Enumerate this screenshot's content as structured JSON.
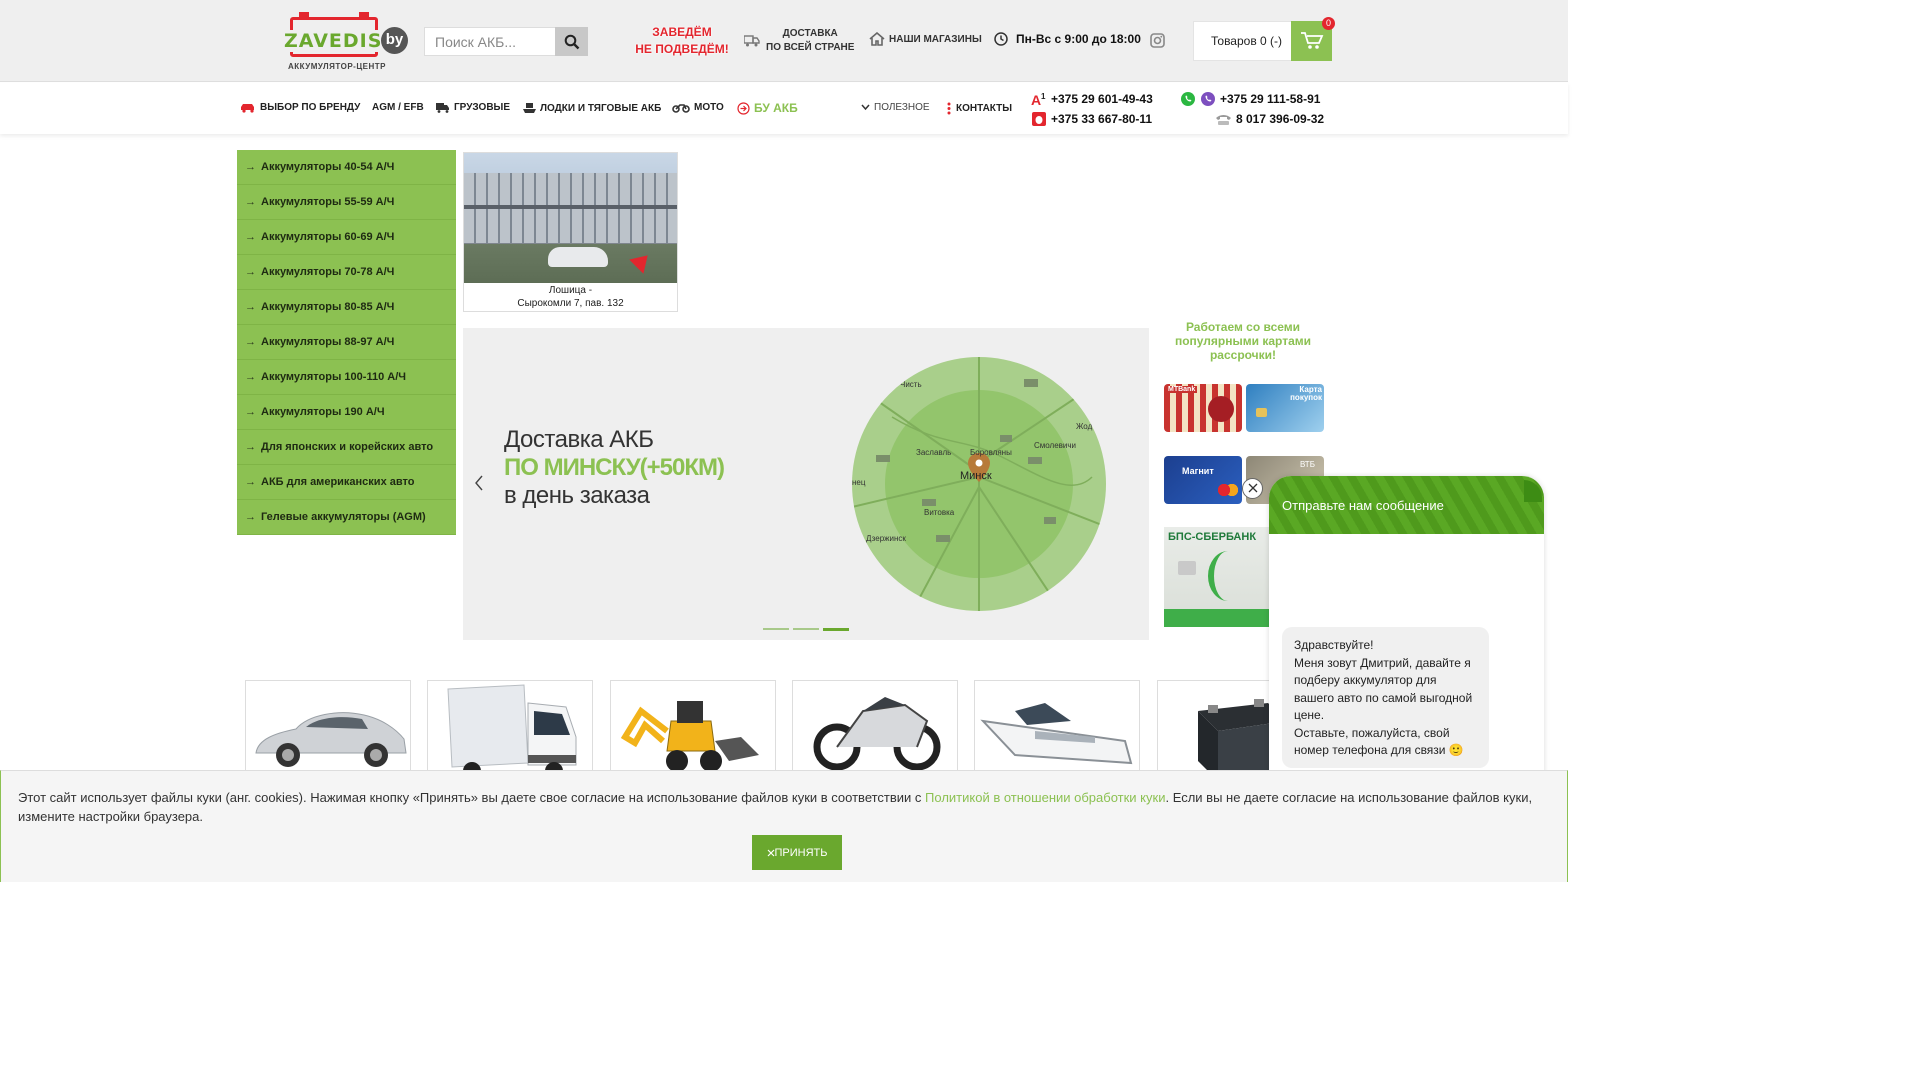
{
  "header": {
    "logo": {
      "word": "ZAVEDIS",
      "domain": "by",
      "subtitle": "АККУМУЛЯТОР-ЦЕНТР"
    },
    "search": {
      "placeholder": "Поиск АКБ..."
    },
    "slogan": {
      "line1": "ЗАВЕДЁМ",
      "line2": "НЕ ПОДВЕДЁМ!"
    },
    "delivery": {
      "line1": "ДОСТАВКА",
      "line2": "ПО ВСЕЙ СТРАНЕ"
    },
    "stores_label": "НАШИ МАГАЗИНЫ",
    "hours": "Пн-Вс с 9:00 до 18:00",
    "cart": {
      "label": "Товаров 0 (-)",
      "count": "0"
    }
  },
  "nav": {
    "brand": "ВЫБОР ПО БРЕНДУ",
    "agm": "AGM / EFB",
    "trucks": "ГРУЗОВЫЕ",
    "boats": "ЛОДКИ И ТЯГОВЫЕ АКБ",
    "moto": "МОТО",
    "used": "БУ АКБ",
    "useful": "ПОЛЕЗНОЕ",
    "contacts": "КОНТАКТЫ"
  },
  "phones": {
    "a1": "+375 29 601-49-43",
    "mts": "+375 33 667-80-11",
    "viber": "+375 29 111-58-91",
    "city": "8 017 396-09-32"
  },
  "sidebar": {
    "items": [
      "Аккумуляторы 40-54 А/Ч",
      "Аккумуляторы 55-59 А/Ч",
      "Аккумуляторы 60-69 А/Ч",
      "Аккумуляторы 70-78 А/Ч",
      "Аккумуляторы 80-85 А/Ч",
      "Аккумуляторы 88-97 А/Ч",
      "Аккумуляторы 100-110 А/Ч",
      "Аккумуляторы 190 А/Ч",
      "Для японских и корейских авто",
      "АКБ для американских авто",
      "Гелевые аккумуляторы (AGM)"
    ]
  },
  "store": {
    "line1": "Лошица -",
    "line2": "Сырокомли 7, пав. 132"
  },
  "slider": {
    "line1": "Доставка АКБ",
    "line2": "ПО МИНСКУ(+50КМ)",
    "line3": "в день заказа",
    "map_labels": {
      "city": "Минск",
      "n1": "Чисть",
      "n2": "Заславль",
      "n3": "Боровляны",
      "n4": "Смолевичи",
      "n5": "Витовка",
      "n6": "Дзержинск",
      "n7": "Жод",
      "n8": "нец"
    },
    "slide_count": 3,
    "active_slide": 3
  },
  "installments": {
    "title": "Работаем со всеми популярными картами рассрочки!",
    "cards": [
      "MTBank",
      "Карта покупок",
      "Магнит",
      "ВТБ",
      "БПС-СБЕРБАНК"
    ]
  },
  "chat": {
    "title": "Отправьте нам сообщение",
    "message": "Здравствуйте!\nМеня зовут Дмитрий, давайте я подберу аккумулятор для вашего авто по самой выгодной цене.\nОставьте, пожалуйста, свой номер телефона для связи 🙂"
  },
  "cookie": {
    "text_before": "Этот сайт использует файлы куки (анг. cookies). Нажимая кнопку «Принять» вы даете свое согласие на использование файлов куки в соответствии с ",
    "link": "Политикой в отношении обработки куки",
    "text_after": ". Если вы не даете согласие на использование файлов куки, измените настройки браузера.",
    "accept": "ПРИНЯТЬ"
  },
  "colors": {
    "accent": "#8cc152",
    "accent_dark": "#6aa82e",
    "red": "#e3262e"
  }
}
